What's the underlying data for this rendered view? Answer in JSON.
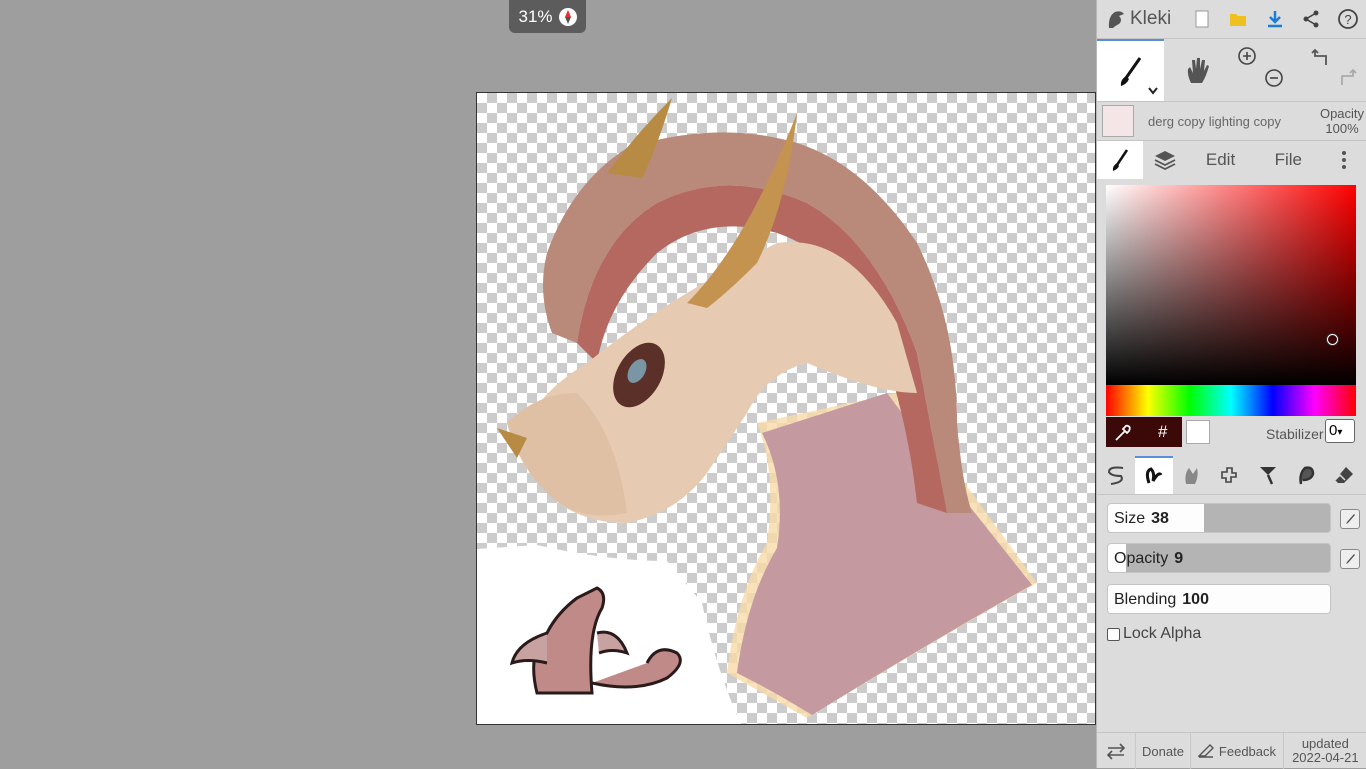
{
  "app": {
    "name": "Kleki"
  },
  "zoom": {
    "value": "31%"
  },
  "layer": {
    "name": "derg copy lighting copy",
    "opacity_label": "Opacity",
    "opacity_value": "100%"
  },
  "tabs": [
    {
      "label": ""
    },
    {
      "label": ""
    },
    {
      "label": "Edit"
    },
    {
      "label": "File"
    }
  ],
  "color": {
    "primary": "#3a0908",
    "secondary": "#ffffff",
    "hex_symbol": "#"
  },
  "stabilizer": {
    "label": "Stabilizer",
    "value": "0"
  },
  "sliders": {
    "size": {
      "label": "Size",
      "value": "38"
    },
    "opacity": {
      "label": "Opacity",
      "value": "9"
    },
    "blending": {
      "label": "Blending",
      "value": "100"
    }
  },
  "lock_alpha": {
    "label": "Lock Alpha",
    "checked": false
  },
  "footer": {
    "donate": "Donate",
    "feedback": "Feedback",
    "updated_label": "updated",
    "updated_date": "2022-04-21"
  }
}
